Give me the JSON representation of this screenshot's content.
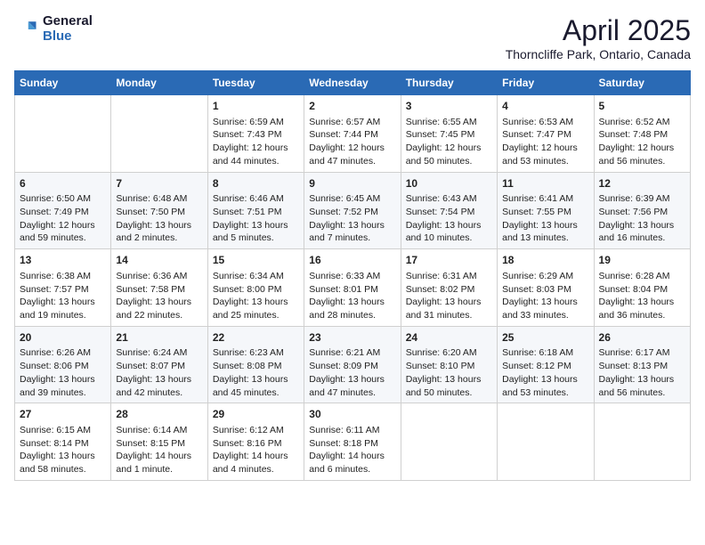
{
  "logo": {
    "general": "General",
    "blue": "Blue"
  },
  "title": {
    "main": "April 2025",
    "sub": "Thorncliffe Park, Ontario, Canada"
  },
  "days_header": [
    "Sunday",
    "Monday",
    "Tuesday",
    "Wednesday",
    "Thursday",
    "Friday",
    "Saturday"
  ],
  "weeks": [
    [
      {
        "day": "",
        "info": ""
      },
      {
        "day": "",
        "info": ""
      },
      {
        "day": "1",
        "info": "Sunrise: 6:59 AM\nSunset: 7:43 PM\nDaylight: 12 hours and 44 minutes."
      },
      {
        "day": "2",
        "info": "Sunrise: 6:57 AM\nSunset: 7:44 PM\nDaylight: 12 hours and 47 minutes."
      },
      {
        "day": "3",
        "info": "Sunrise: 6:55 AM\nSunset: 7:45 PM\nDaylight: 12 hours and 50 minutes."
      },
      {
        "day": "4",
        "info": "Sunrise: 6:53 AM\nSunset: 7:47 PM\nDaylight: 12 hours and 53 minutes."
      },
      {
        "day": "5",
        "info": "Sunrise: 6:52 AM\nSunset: 7:48 PM\nDaylight: 12 hours and 56 minutes."
      }
    ],
    [
      {
        "day": "6",
        "info": "Sunrise: 6:50 AM\nSunset: 7:49 PM\nDaylight: 12 hours and 59 minutes."
      },
      {
        "day": "7",
        "info": "Sunrise: 6:48 AM\nSunset: 7:50 PM\nDaylight: 13 hours and 2 minutes."
      },
      {
        "day": "8",
        "info": "Sunrise: 6:46 AM\nSunset: 7:51 PM\nDaylight: 13 hours and 5 minutes."
      },
      {
        "day": "9",
        "info": "Sunrise: 6:45 AM\nSunset: 7:52 PM\nDaylight: 13 hours and 7 minutes."
      },
      {
        "day": "10",
        "info": "Sunrise: 6:43 AM\nSunset: 7:54 PM\nDaylight: 13 hours and 10 minutes."
      },
      {
        "day": "11",
        "info": "Sunrise: 6:41 AM\nSunset: 7:55 PM\nDaylight: 13 hours and 13 minutes."
      },
      {
        "day": "12",
        "info": "Sunrise: 6:39 AM\nSunset: 7:56 PM\nDaylight: 13 hours and 16 minutes."
      }
    ],
    [
      {
        "day": "13",
        "info": "Sunrise: 6:38 AM\nSunset: 7:57 PM\nDaylight: 13 hours and 19 minutes."
      },
      {
        "day": "14",
        "info": "Sunrise: 6:36 AM\nSunset: 7:58 PM\nDaylight: 13 hours and 22 minutes."
      },
      {
        "day": "15",
        "info": "Sunrise: 6:34 AM\nSunset: 8:00 PM\nDaylight: 13 hours and 25 minutes."
      },
      {
        "day": "16",
        "info": "Sunrise: 6:33 AM\nSunset: 8:01 PM\nDaylight: 13 hours and 28 minutes."
      },
      {
        "day": "17",
        "info": "Sunrise: 6:31 AM\nSunset: 8:02 PM\nDaylight: 13 hours and 31 minutes."
      },
      {
        "day": "18",
        "info": "Sunrise: 6:29 AM\nSunset: 8:03 PM\nDaylight: 13 hours and 33 minutes."
      },
      {
        "day": "19",
        "info": "Sunrise: 6:28 AM\nSunset: 8:04 PM\nDaylight: 13 hours and 36 minutes."
      }
    ],
    [
      {
        "day": "20",
        "info": "Sunrise: 6:26 AM\nSunset: 8:06 PM\nDaylight: 13 hours and 39 minutes."
      },
      {
        "day": "21",
        "info": "Sunrise: 6:24 AM\nSunset: 8:07 PM\nDaylight: 13 hours and 42 minutes."
      },
      {
        "day": "22",
        "info": "Sunrise: 6:23 AM\nSunset: 8:08 PM\nDaylight: 13 hours and 45 minutes."
      },
      {
        "day": "23",
        "info": "Sunrise: 6:21 AM\nSunset: 8:09 PM\nDaylight: 13 hours and 47 minutes."
      },
      {
        "day": "24",
        "info": "Sunrise: 6:20 AM\nSunset: 8:10 PM\nDaylight: 13 hours and 50 minutes."
      },
      {
        "day": "25",
        "info": "Sunrise: 6:18 AM\nSunset: 8:12 PM\nDaylight: 13 hours and 53 minutes."
      },
      {
        "day": "26",
        "info": "Sunrise: 6:17 AM\nSunset: 8:13 PM\nDaylight: 13 hours and 56 minutes."
      }
    ],
    [
      {
        "day": "27",
        "info": "Sunrise: 6:15 AM\nSunset: 8:14 PM\nDaylight: 13 hours and 58 minutes."
      },
      {
        "day": "28",
        "info": "Sunrise: 6:14 AM\nSunset: 8:15 PM\nDaylight: 14 hours and 1 minute."
      },
      {
        "day": "29",
        "info": "Sunrise: 6:12 AM\nSunset: 8:16 PM\nDaylight: 14 hours and 4 minutes."
      },
      {
        "day": "30",
        "info": "Sunrise: 6:11 AM\nSunset: 8:18 PM\nDaylight: 14 hours and 6 minutes."
      },
      {
        "day": "",
        "info": ""
      },
      {
        "day": "",
        "info": ""
      },
      {
        "day": "",
        "info": ""
      }
    ]
  ]
}
